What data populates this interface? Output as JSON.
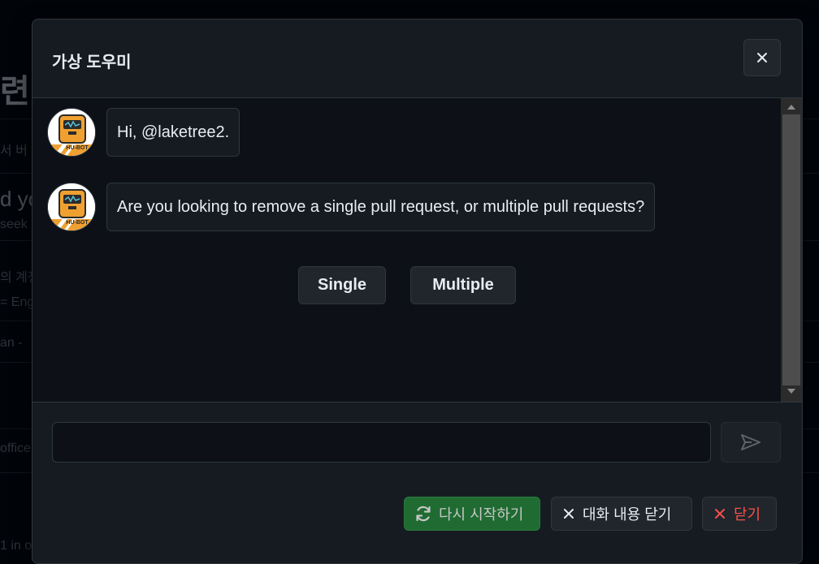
{
  "background": {
    "fragments": [
      "련",
      "서 버",
      "d yo",
      "seek",
      "의 계정",
      "= Eng",
      "an - ",
      "office",
      "1 in o"
    ]
  },
  "modal": {
    "title": "가상 도우미",
    "close_icon": "close-icon"
  },
  "chat": {
    "messages": [
      {
        "sender": "HU-BOT",
        "text": "Hi, @laketree2."
      },
      {
        "sender": "HU-BOT",
        "text": "Are you looking to remove a single pull request, or multiple pull requests?"
      }
    ],
    "avatar_label": "HU-BOT",
    "choices": [
      "Single",
      "Multiple"
    ]
  },
  "composer": {
    "input_value": "",
    "input_placeholder": "",
    "send_icon": "send-icon"
  },
  "footer": {
    "restart_label": "다시 시작하기",
    "restart_icon": "refresh-icon",
    "clear_label": "대화 내용 닫기",
    "clear_icon": "x-icon",
    "close_label": "닫기",
    "close_icon": "x-icon"
  },
  "colors": {
    "accent_green": "#238636",
    "danger_red": "#f85149",
    "bot_orange": "#f0a030"
  }
}
